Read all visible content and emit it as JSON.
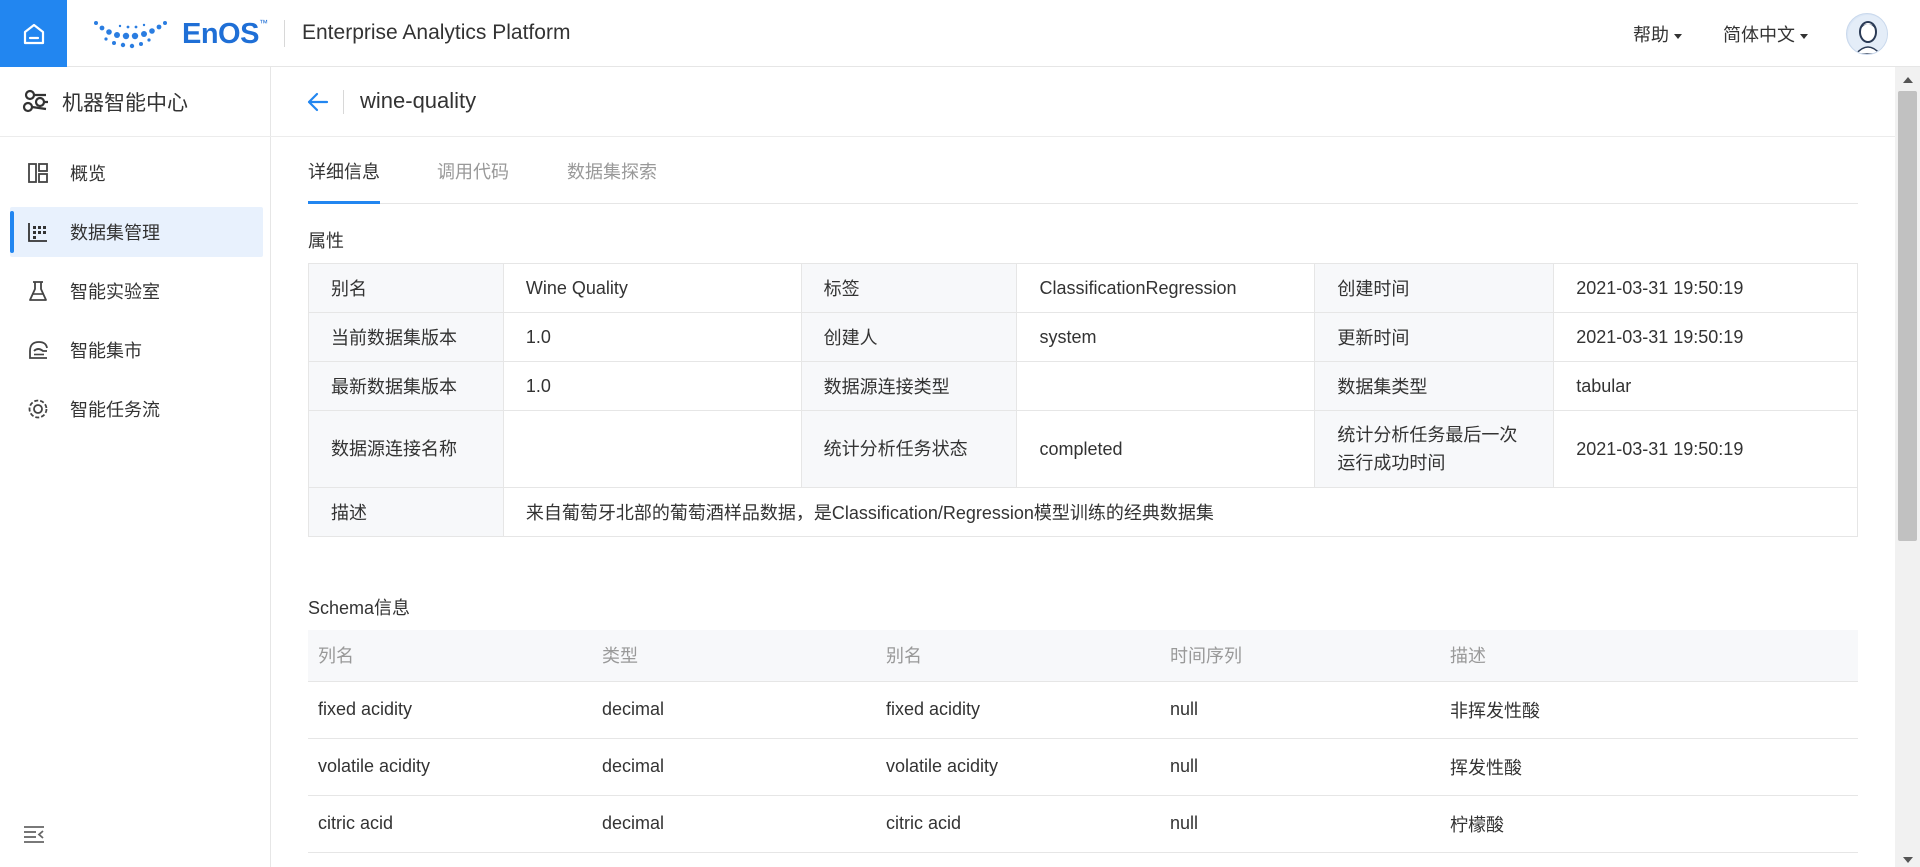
{
  "header": {
    "logo_text": "EnOS",
    "logo_tm": "™",
    "platform_title": "Enterprise Analytics Platform",
    "help_label": "帮助",
    "language_label": "简体中文"
  },
  "sidebar": {
    "title": "机器智能中心",
    "items": [
      {
        "label": "概览"
      },
      {
        "label": "数据集管理"
      },
      {
        "label": "智能实验室"
      },
      {
        "label": "智能集市"
      },
      {
        "label": "智能任务流"
      }
    ]
  },
  "page": {
    "title": "wine-quality",
    "tabs": [
      {
        "label": "详细信息"
      },
      {
        "label": "调用代码"
      },
      {
        "label": "数据集探索"
      }
    ],
    "attributes_label": "属性",
    "attributes": {
      "alias_key": "别名",
      "alias_val": "Wine Quality",
      "tag_key": "标签",
      "tag_val": "ClassificationRegression",
      "created_key": "创建时间",
      "created_val": "2021-03-31 19:50:19",
      "cur_ver_key": "当前数据集版本",
      "cur_ver_val": "1.0",
      "creator_key": "创建人",
      "creator_val": "system",
      "updated_key": "更新时间",
      "updated_val": "2021-03-31 19:50:19",
      "latest_ver_key": "最新数据集版本",
      "latest_ver_val": "1.0",
      "conn_type_key": "数据源连接类型",
      "conn_type_val": "",
      "ds_type_key": "数据集类型",
      "ds_type_val": "tabular",
      "conn_name_key": "数据源连接名称",
      "conn_name_val": "",
      "stat_status_key": "统计分析任务状态",
      "stat_status_val": "completed",
      "stat_last_key_1": "统计分析任务最后一次",
      "stat_last_key_2": "运行成功时间",
      "stat_last_val": "2021-03-31 19:50:19",
      "desc_key": "描述",
      "desc_val": "来自葡萄牙北部的葡萄酒样品数据，是Classification/Regression模型训练的经典数据集"
    },
    "schema_label": "Schema信息",
    "schema": {
      "columns": [
        "列名",
        "类型",
        "别名",
        "时间序列",
        "描述"
      ],
      "rows": [
        [
          "fixed acidity",
          "decimal",
          "fixed acidity",
          "null",
          "非挥发性酸"
        ],
        [
          "volatile acidity",
          "decimal",
          "volatile acidity",
          "null",
          "挥发性酸"
        ],
        [
          "citric acid",
          "decimal",
          "citric acid",
          "null",
          "柠檬酸"
        ]
      ]
    }
  },
  "colors": {
    "accent": "#2286f0",
    "logo": "#1f6fd6",
    "key_cell_bg": "#f7f8fa",
    "active_nav_bg": "#e8f1fd"
  }
}
